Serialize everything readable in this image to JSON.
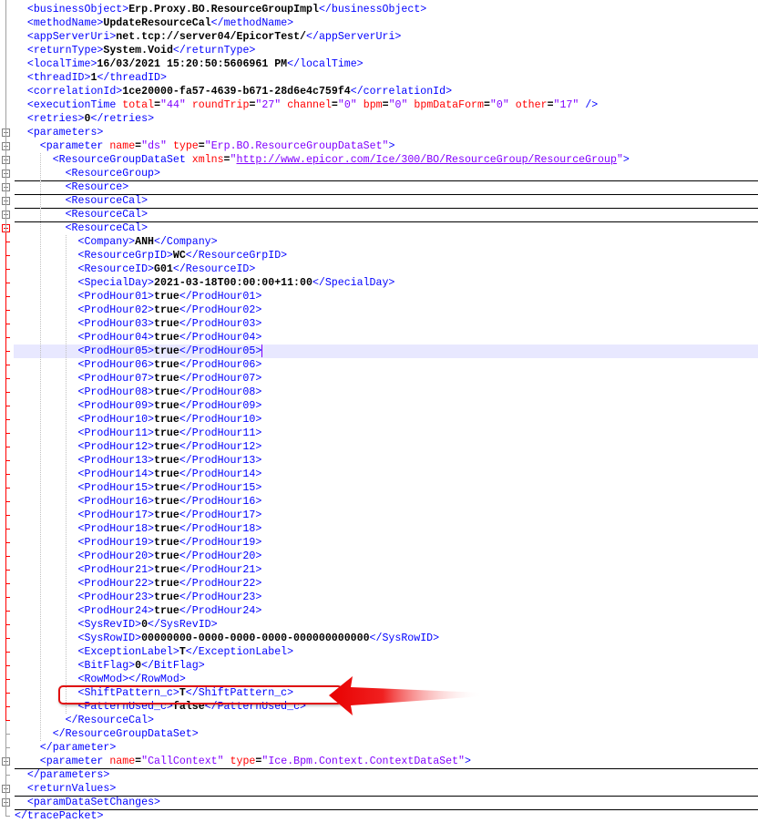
{
  "lines": [
    {
      "parts": [
        [
          "tag",
          "<businessObject>"
        ],
        [
          "text",
          "Erp.Proxy.BO.ResourceGroupImpl"
        ],
        [
          "tag",
          "</businessObject>"
        ]
      ]
    },
    {
      "parts": [
        [
          "tag",
          "<methodName>"
        ],
        [
          "text",
          "UpdateResourceCal"
        ],
        [
          "tag",
          "</methodName>"
        ]
      ]
    },
    {
      "parts": [
        [
          "tag",
          "<appServerUri>"
        ],
        [
          "text",
          "net.tcp://server04/EpicorTest/"
        ],
        [
          "tag",
          "</appServerUri>"
        ]
      ]
    },
    {
      "parts": [
        [
          "tag",
          "<returnType>"
        ],
        [
          "text",
          "System.Void"
        ],
        [
          "tag",
          "</returnType>"
        ]
      ]
    },
    {
      "parts": [
        [
          "tag",
          "<localTime>"
        ],
        [
          "text",
          "16/03/2021 15:20:50:5606961 PM"
        ],
        [
          "tag",
          "</localTime>"
        ]
      ]
    },
    {
      "parts": [
        [
          "tag",
          "<threadID>"
        ],
        [
          "text",
          "1"
        ],
        [
          "tag",
          "</threadID>"
        ]
      ]
    },
    {
      "parts": [
        [
          "tag",
          "<correlationId>"
        ],
        [
          "text",
          "1ce20000-fa57-4639-b671-28d6e4c759f4"
        ],
        [
          "tag",
          "</correlationId>"
        ]
      ]
    },
    {
      "parts": [
        [
          "tag",
          "<executionTime "
        ],
        [
          "attr",
          "total"
        ],
        [
          "text",
          "="
        ],
        [
          "val",
          "\"44\" "
        ],
        [
          "attr",
          "roundTrip"
        ],
        [
          "text",
          "="
        ],
        [
          "val",
          "\"27\" "
        ],
        [
          "attr",
          "channel"
        ],
        [
          "text",
          "="
        ],
        [
          "val",
          "\"0\" "
        ],
        [
          "attr",
          "bpm"
        ],
        [
          "text",
          "="
        ],
        [
          "val",
          "\"0\" "
        ],
        [
          "attr",
          "bpmDataForm"
        ],
        [
          "text",
          "="
        ],
        [
          "val",
          "\"0\" "
        ],
        [
          "attr",
          "other"
        ],
        [
          "text",
          "="
        ],
        [
          "val",
          "\"17\" "
        ],
        [
          "tag",
          "/>"
        ]
      ]
    },
    {
      "parts": [
        [
          "tag",
          "<retries>"
        ],
        [
          "text",
          "0"
        ],
        [
          "tag",
          "</retries>"
        ]
      ]
    },
    {
      "parts": [
        [
          "tag",
          "<parameters>"
        ]
      ]
    },
    {
      "parts": [
        [
          "tag",
          "<parameter "
        ],
        [
          "attr",
          "name"
        ],
        [
          "text",
          "="
        ],
        [
          "val",
          "\"ds\" "
        ],
        [
          "attr",
          "type"
        ],
        [
          "text",
          "="
        ],
        [
          "val",
          "\"Erp.BO.ResourceGroupDataSet\""
        ],
        [
          "tag",
          ">"
        ]
      ]
    },
    {
      "parts": [
        [
          "tag",
          "<ResourceGroupDataSet "
        ],
        [
          "attr",
          "xmlns"
        ],
        [
          "text",
          "="
        ],
        [
          "val",
          "\""
        ],
        [
          "link",
          "http://www.epicor.com/Ice/300/BO/ResourceGroup/ResourceGroup"
        ],
        [
          "val",
          "\""
        ],
        [
          "tag",
          ">"
        ]
      ]
    },
    {
      "parts": [
        [
          "tag",
          "<ResourceGroup>"
        ]
      ]
    },
    {
      "parts": [
        [
          "tag",
          "<Resource>"
        ]
      ]
    },
    {
      "parts": [
        [
          "tag",
          "<ResourceCal>"
        ]
      ]
    },
    {
      "parts": [
        [
          "tag",
          "<ResourceCal>"
        ]
      ]
    },
    {
      "parts": [
        [
          "tag",
          "<ResourceCal>"
        ]
      ]
    },
    {
      "parts": [
        [
          "tag",
          "<Company>"
        ],
        [
          "text",
          "ANH"
        ],
        [
          "tag",
          "</Company>"
        ]
      ]
    },
    {
      "parts": [
        [
          "tag",
          "<ResourceGrpID>"
        ],
        [
          "text",
          "WC"
        ],
        [
          "tag",
          "</ResourceGrpID>"
        ]
      ]
    },
    {
      "parts": [
        [
          "tag",
          "<ResourceID>"
        ],
        [
          "text",
          "G01"
        ],
        [
          "tag",
          "</ResourceID>"
        ]
      ]
    },
    {
      "parts": [
        [
          "tag",
          "<SpecialDay>"
        ],
        [
          "text",
          "2021-03-18T00:00:00+11:00"
        ],
        [
          "tag",
          "</SpecialDay>"
        ]
      ]
    },
    {
      "parts": [
        [
          "tag",
          "<ProdHour01>"
        ],
        [
          "text",
          "true"
        ],
        [
          "tag",
          "</ProdHour01>"
        ]
      ]
    },
    {
      "parts": [
        [
          "tag",
          "<ProdHour02>"
        ],
        [
          "text",
          "true"
        ],
        [
          "tag",
          "</ProdHour02>"
        ]
      ]
    },
    {
      "parts": [
        [
          "tag",
          "<ProdHour03>"
        ],
        [
          "text",
          "true"
        ],
        [
          "tag",
          "</ProdHour03>"
        ]
      ]
    },
    {
      "parts": [
        [
          "tag",
          "<ProdHour04>"
        ],
        [
          "text",
          "true"
        ],
        [
          "tag",
          "</ProdHour04>"
        ]
      ]
    },
    {
      "parts": [
        [
          "tag",
          "<ProdHour05>"
        ],
        [
          "text",
          "true"
        ],
        [
          "tag",
          "</ProdHour05>"
        ]
      ]
    },
    {
      "parts": [
        [
          "tag",
          "<ProdHour06>"
        ],
        [
          "text",
          "true"
        ],
        [
          "tag",
          "</ProdHour06>"
        ]
      ]
    },
    {
      "parts": [
        [
          "tag",
          "<ProdHour07>"
        ],
        [
          "text",
          "true"
        ],
        [
          "tag",
          "</ProdHour07>"
        ]
      ]
    },
    {
      "parts": [
        [
          "tag",
          "<ProdHour08>"
        ],
        [
          "text",
          "true"
        ],
        [
          "tag",
          "</ProdHour08>"
        ]
      ]
    },
    {
      "parts": [
        [
          "tag",
          "<ProdHour09>"
        ],
        [
          "text",
          "true"
        ],
        [
          "tag",
          "</ProdHour09>"
        ]
      ]
    },
    {
      "parts": [
        [
          "tag",
          "<ProdHour10>"
        ],
        [
          "text",
          "true"
        ],
        [
          "tag",
          "</ProdHour10>"
        ]
      ]
    },
    {
      "parts": [
        [
          "tag",
          "<ProdHour11>"
        ],
        [
          "text",
          "true"
        ],
        [
          "tag",
          "</ProdHour11>"
        ]
      ]
    },
    {
      "parts": [
        [
          "tag",
          "<ProdHour12>"
        ],
        [
          "text",
          "true"
        ],
        [
          "tag",
          "</ProdHour12>"
        ]
      ]
    },
    {
      "parts": [
        [
          "tag",
          "<ProdHour13>"
        ],
        [
          "text",
          "true"
        ],
        [
          "tag",
          "</ProdHour13>"
        ]
      ]
    },
    {
      "parts": [
        [
          "tag",
          "<ProdHour14>"
        ],
        [
          "text",
          "true"
        ],
        [
          "tag",
          "</ProdHour14>"
        ]
      ]
    },
    {
      "parts": [
        [
          "tag",
          "<ProdHour15>"
        ],
        [
          "text",
          "true"
        ],
        [
          "tag",
          "</ProdHour15>"
        ]
      ]
    },
    {
      "parts": [
        [
          "tag",
          "<ProdHour16>"
        ],
        [
          "text",
          "true"
        ],
        [
          "tag",
          "</ProdHour16>"
        ]
      ]
    },
    {
      "parts": [
        [
          "tag",
          "<ProdHour17>"
        ],
        [
          "text",
          "true"
        ],
        [
          "tag",
          "</ProdHour17>"
        ]
      ]
    },
    {
      "parts": [
        [
          "tag",
          "<ProdHour18>"
        ],
        [
          "text",
          "true"
        ],
        [
          "tag",
          "</ProdHour18>"
        ]
      ]
    },
    {
      "parts": [
        [
          "tag",
          "<ProdHour19>"
        ],
        [
          "text",
          "true"
        ],
        [
          "tag",
          "</ProdHour19>"
        ]
      ]
    },
    {
      "parts": [
        [
          "tag",
          "<ProdHour20>"
        ],
        [
          "text",
          "true"
        ],
        [
          "tag",
          "</ProdHour20>"
        ]
      ]
    },
    {
      "parts": [
        [
          "tag",
          "<ProdHour21>"
        ],
        [
          "text",
          "true"
        ],
        [
          "tag",
          "</ProdHour21>"
        ]
      ]
    },
    {
      "parts": [
        [
          "tag",
          "<ProdHour22>"
        ],
        [
          "text",
          "true"
        ],
        [
          "tag",
          "</ProdHour22>"
        ]
      ]
    },
    {
      "parts": [
        [
          "tag",
          "<ProdHour23>"
        ],
        [
          "text",
          "true"
        ],
        [
          "tag",
          "</ProdHour23>"
        ]
      ]
    },
    {
      "parts": [
        [
          "tag",
          "<ProdHour24>"
        ],
        [
          "text",
          "true"
        ],
        [
          "tag",
          "</ProdHour24>"
        ]
      ]
    },
    {
      "parts": [
        [
          "tag",
          "<SysRevID>"
        ],
        [
          "text",
          "0"
        ],
        [
          "tag",
          "</SysRevID>"
        ]
      ]
    },
    {
      "parts": [
        [
          "tag",
          "<SysRowID>"
        ],
        [
          "text",
          "00000000-0000-0000-0000-000000000000"
        ],
        [
          "tag",
          "</SysRowID>"
        ]
      ]
    },
    {
      "parts": [
        [
          "tag",
          "<ExceptionLabel>"
        ],
        [
          "text",
          "T"
        ],
        [
          "tag",
          "</ExceptionLabel>"
        ]
      ]
    },
    {
      "parts": [
        [
          "tag",
          "<BitFlag>"
        ],
        [
          "text",
          "0"
        ],
        [
          "tag",
          "</BitFlag>"
        ]
      ]
    },
    {
      "parts": [
        [
          "tag",
          "<RowMod>"
        ],
        [
          "tag",
          "</RowMod>"
        ]
      ]
    },
    {
      "parts": [
        [
          "tag",
          "<ShiftPattern_c>"
        ],
        [
          "text",
          "T"
        ],
        [
          "tag",
          "</ShiftPattern_c>"
        ]
      ]
    },
    {
      "parts": [
        [
          "tag",
          "<PatternUsed_c>"
        ],
        [
          "text",
          "false"
        ],
        [
          "tag",
          "</PatternUsed_c>"
        ]
      ]
    },
    {
      "parts": [
        [
          "tag",
          "</ResourceCal>"
        ]
      ]
    },
    {
      "parts": [
        [
          "tag",
          "</ResourceGroupDataSet>"
        ]
      ]
    },
    {
      "parts": [
        [
          "tag",
          "</parameter>"
        ]
      ]
    },
    {
      "parts": [
        [
          "tag",
          "<parameter "
        ],
        [
          "attr",
          "name"
        ],
        [
          "text",
          "="
        ],
        [
          "val",
          "\"CallContext\" "
        ],
        [
          "attr",
          "type"
        ],
        [
          "text",
          "="
        ],
        [
          "val",
          "\"Ice.Bpm.Context.ContextDataSet\""
        ],
        [
          "tag",
          ">"
        ]
      ]
    },
    {
      "parts": [
        [
          "tag",
          "</parameters>"
        ]
      ]
    },
    {
      "parts": [
        [
          "tag",
          "<returnValues>"
        ]
      ]
    },
    {
      "parts": [
        [
          "tag",
          "<paramDataSetChanges>"
        ]
      ]
    },
    {
      "parts": [
        [
          "tag",
          "</tracePacket>"
        ]
      ]
    }
  ],
  "highlighted_line": 26,
  "callout_line": 51,
  "colors": {
    "tag": "#0000ff",
    "attr": "#ff0000",
    "value": "#8000ff",
    "callout": "#e01010",
    "highlight": "#e8e8ff"
  }
}
